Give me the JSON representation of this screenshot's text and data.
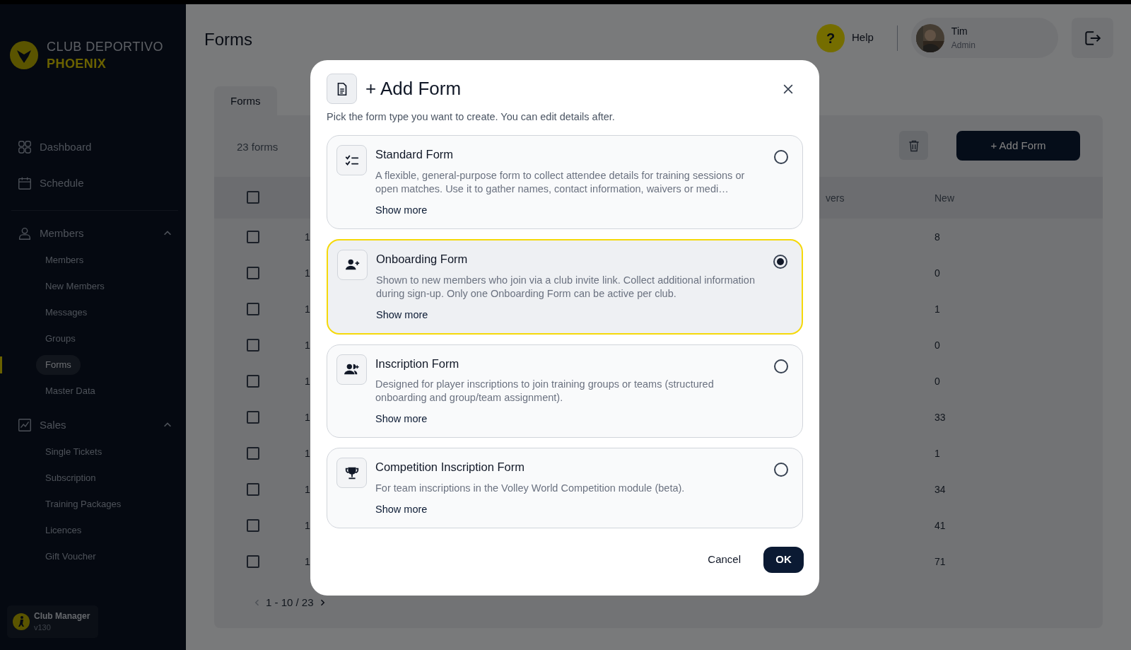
{
  "sidebar": {
    "brand": {
      "line_1": "CLUB DEPORTIVO",
      "line_2": "PHOENIX"
    },
    "top_items": [
      {
        "label": "Dashboard",
        "kind": "dashboard",
        "selected": false
      },
      {
        "label": "Schedule",
        "kind": "calendar",
        "selected": false
      }
    ],
    "sections": [
      {
        "label": "Members",
        "kind": "person",
        "expanded": true,
        "children": [
          {
            "label": "Members",
            "selected": false
          },
          {
            "label": "New Members",
            "selected": false
          },
          {
            "label": "Messages",
            "selected": false
          },
          {
            "label": "Groups",
            "selected": false
          },
          {
            "label": "Forms",
            "selected": true
          },
          {
            "label": "Master Data",
            "selected": false
          }
        ]
      },
      {
        "label": "Sales",
        "kind": "chart",
        "expanded": true,
        "children": [
          {
            "label": "Single Tickets",
            "selected": false
          },
          {
            "label": "Subscription",
            "selected": false
          },
          {
            "label": "Training Packages",
            "selected": false
          },
          {
            "label": "Licences",
            "selected": false
          },
          {
            "label": "Gift Voucher",
            "selected": false
          }
        ]
      }
    ],
    "footer": {
      "title": "Club Manager",
      "version": "v130"
    }
  },
  "header": {
    "title": "Forms",
    "help_glyph": "?",
    "help_label": "Help",
    "user": {
      "name": "Tim",
      "role": "Admin"
    }
  },
  "tabs": [
    {
      "label": "Forms",
      "selected": true
    }
  ],
  "toolbar": {
    "count": "23 forms",
    "add_button": "+ Add Form"
  },
  "table": {
    "header_checked": false,
    "columns": [
      {
        "label": "vers"
      },
      {
        "label": "New"
      }
    ],
    "rows": [
      {
        "checked": false,
        "column_2": "1",
        "new": "8"
      },
      {
        "checked": false,
        "column_2": "1",
        "new": "0"
      },
      {
        "checked": false,
        "column_2": "1",
        "new": "1"
      },
      {
        "checked": false,
        "column_2": "1",
        "new": "0"
      },
      {
        "checked": false,
        "column_2": "1",
        "new": "0"
      },
      {
        "checked": false,
        "column_2": "1",
        "new": "33"
      },
      {
        "checked": false,
        "column_2": "1",
        "new": "1"
      },
      {
        "checked": false,
        "column_2": "1",
        "new": "34"
      },
      {
        "checked": false,
        "column_2": "1",
        "new": "41"
      },
      {
        "checked": false,
        "column_2": "1",
        "new": "71"
      }
    ],
    "pagination": "1 - 10 / 23"
  },
  "dialog": {
    "title": "+ Add Form",
    "subtitle": "Pick the form type you want to create. You can edit details after.",
    "options": [
      {
        "kind": "checklist",
        "title": "Standard Form",
        "description": "A flexible, general-purpose form to collect attendee details for training sessions or open matches. Use it to gather names, contact information, waivers or medi…",
        "link": "Show more",
        "selected": false
      },
      {
        "kind": "user-plus",
        "title": "Onboarding Form",
        "description": "Shown to new members who join via a club invite link. Collect additional information during sign-up. Only one Onboarding Form can be active per club.",
        "link": "Show more",
        "selected": true
      },
      {
        "kind": "users-plus",
        "title": "Inscription Form",
        "description": "Designed for player inscriptions to join training groups or teams (structured onboarding and group/team assignment).",
        "link": "Show more",
        "selected": false
      },
      {
        "kind": "trophy",
        "title": "Competition Inscription Form",
        "description": "For team inscriptions in the Volley World Competition module (beta).",
        "link": "Show more",
        "selected": false
      }
    ],
    "cancel": "Cancel",
    "ok": "OK"
  }
}
